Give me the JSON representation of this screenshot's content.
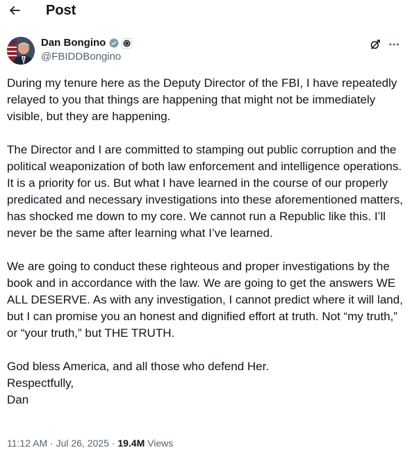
{
  "header": {
    "back_icon": "arrow-left-icon",
    "title": "Post"
  },
  "author": {
    "display_name": "Dan Bongino",
    "handle": "@FBIDDBongino",
    "verified_icon": "verified-badge-icon",
    "affiliation_icon": "government-seal-icon",
    "verified_color": "#829aab"
  },
  "actions": {
    "grok_icon": "grok-icon",
    "more_icon": "more-horizontal-icon"
  },
  "post": {
    "paragraphs": [
      "During my tenure here as the Deputy Director of the FBI, I have repeatedly relayed to you that things are happening that might not be immediately visible, but they are happening.",
      "The Director and I are committed to stamping out public corruption and the political weaponization of both law enforcement and intelligence operations. It is a priority for us. But what I have learned in the course of our properly predicated and necessary investigations into these aforementioned matters, has shocked me down to my core. We cannot run a Republic like this. I’ll never be the same after learning what I’ve learned.",
      "We are going to conduct these righteous and proper investigations by the book and in accordance with the law. We are going to get the answers WE ALL DESERVE. As with any investigation, I cannot predict where it will land, but I can promise you an honest and dignified effort at truth. Not “my truth,” or “your truth,” but THE TRUTH.",
      "God bless America, and all those who defend Her.",
      "Respectfully,",
      "Dan"
    ]
  },
  "meta": {
    "time": "11:12 AM",
    "separator": "·",
    "date": "Jul 26, 2025",
    "views_count": "19.4M",
    "views_label": "Views"
  },
  "colors": {
    "text_primary": "#0f1419",
    "text_secondary": "#536471"
  }
}
